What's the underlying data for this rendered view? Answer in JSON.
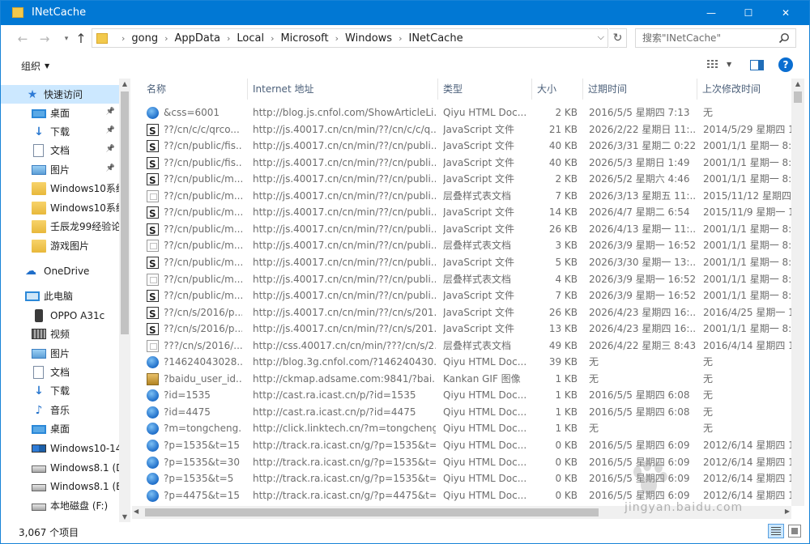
{
  "window": {
    "title": "INetCache",
    "controls": {
      "minimize": "—",
      "maximize": "☐",
      "close": "✕"
    }
  },
  "address": {
    "breadcrumbs": [
      "gong",
      "AppData",
      "Local",
      "Microsoft",
      "Windows",
      "INetCache"
    ],
    "search_placeholder": "搜索\"INetCache\""
  },
  "toolbar": {
    "organize_label": "组织"
  },
  "nav": {
    "items": [
      {
        "label": "快速访问",
        "icon": "star-icon",
        "pinned": false,
        "selected": true
      },
      {
        "label": "桌面",
        "icon": "desktop-icon",
        "pinned": true
      },
      {
        "label": "下载",
        "icon": "download-icon",
        "pinned": true
      },
      {
        "label": "文档",
        "icon": "document-icon",
        "pinned": true
      },
      {
        "label": "图片",
        "icon": "pictures-icon",
        "pinned": true
      },
      {
        "label": "Windows10系统",
        "icon": "folder-icon",
        "pinned": false
      },
      {
        "label": "Windows10系统",
        "icon": "folder-icon",
        "pinned": false
      },
      {
        "label": "壬辰龙99经验论",
        "icon": "folder-icon",
        "pinned": false
      },
      {
        "label": "游戏图片",
        "icon": "folder-icon",
        "pinned": false
      },
      {
        "label": "OneDrive",
        "icon": "onedrive-icon",
        "pinned": false
      },
      {
        "label": "此电脑",
        "icon": "this-pc-icon",
        "pinned": false
      },
      {
        "label": "OPPO A31c",
        "icon": "phone-icon",
        "pinned": false
      },
      {
        "label": "视频",
        "icon": "video-icon",
        "pinned": false
      },
      {
        "label": "图片",
        "icon": "pictures-icon",
        "pinned": false
      },
      {
        "label": "文档",
        "icon": "document-icon",
        "pinned": false
      },
      {
        "label": "下载",
        "icon": "download-icon",
        "pinned": false
      },
      {
        "label": "音乐",
        "icon": "music-icon",
        "pinned": false
      },
      {
        "label": "桌面",
        "icon": "desktop-icon",
        "pinned": false
      },
      {
        "label": "Windows10-14",
        "icon": "windows-drive-icon",
        "pinned": false
      },
      {
        "label": "Windows8.1 (D",
        "icon": "drive-icon",
        "pinned": false
      },
      {
        "label": "Windows8.1 (E",
        "icon": "drive-icon",
        "pinned": false
      },
      {
        "label": "本地磁盘 (F:)",
        "icon": "drive-icon",
        "pinned": false
      }
    ]
  },
  "columns": [
    "名称",
    "Internet 地址",
    "类型",
    "大小",
    "过期时间",
    "上次修改时间"
  ],
  "files": [
    {
      "name": "&css=6001",
      "url": "http://blog.js.cnfol.com/ShowArticleLi...",
      "type": "Qiyu HTML Doc...",
      "size": "2 KB",
      "expires": "2016/5/5 星期四 7:13",
      "modified": "无",
      "kind": "html"
    },
    {
      "name": "??/cn/c/c/qrco...",
      "url": "http://js.40017.cn/cn/min/??/cn/c/c/q...",
      "type": "JavaScript 文件",
      "size": "21 KB",
      "expires": "2026/2/22 星期日 11:...",
      "modified": "2014/5/29 星期四 1",
      "kind": "js"
    },
    {
      "name": "??/cn/public/fis...",
      "url": "http://js.40017.cn/cn/min/??/cn/publi...",
      "type": "JavaScript 文件",
      "size": "40 KB",
      "expires": "2026/3/31 星期二 0:22",
      "modified": "2001/1/1 星期一 8:0",
      "kind": "js"
    },
    {
      "name": "??/cn/public/fis...",
      "url": "http://js.40017.cn/cn/min/??/cn/publi...",
      "type": "JavaScript 文件",
      "size": "40 KB",
      "expires": "2026/5/3 星期日 1:49",
      "modified": "2001/1/1 星期一 8:0",
      "kind": "js"
    },
    {
      "name": "??/cn/public/m...",
      "url": "http://js.40017.cn/cn/min/??/cn/publi...",
      "type": "JavaScript 文件",
      "size": "2 KB",
      "expires": "2026/5/2 星期六 4:46",
      "modified": "2001/1/1 星期一 8:0",
      "kind": "js"
    },
    {
      "name": "??/cn/public/m...",
      "url": "http://js.40017.cn/cn/min/??/cn/publi...",
      "type": "层叠样式表文档",
      "size": "7 KB",
      "expires": "2026/3/13 星期五 11:...",
      "modified": "2015/11/12 星期四",
      "kind": "css"
    },
    {
      "name": "??/cn/public/m...",
      "url": "http://js.40017.cn/cn/min/??/cn/publi...",
      "type": "JavaScript 文件",
      "size": "14 KB",
      "expires": "2026/4/7 星期二 6:54",
      "modified": "2015/11/9 星期一 1",
      "kind": "js"
    },
    {
      "name": "??/cn/public/m...",
      "url": "http://js.40017.cn/cn/min/??/cn/publi...",
      "type": "JavaScript 文件",
      "size": "26 KB",
      "expires": "2026/4/13 星期一 11:...",
      "modified": "2001/1/1 星期一 8:0",
      "kind": "js"
    },
    {
      "name": "??/cn/public/m...",
      "url": "http://js.40017.cn/cn/min/??/cn/publi...",
      "type": "层叠样式表文档",
      "size": "3 KB",
      "expires": "2026/3/9 星期一 16:52",
      "modified": "2001/1/1 星期一 8:0",
      "kind": "css"
    },
    {
      "name": "??/cn/public/m...",
      "url": "http://js.40017.cn/cn/min/??/cn/publi...",
      "type": "JavaScript 文件",
      "size": "5 KB",
      "expires": "2026/3/30 星期一 13:...",
      "modified": "2001/1/1 星期一 8:0",
      "kind": "js"
    },
    {
      "name": "??/cn/public/m...",
      "url": "http://js.40017.cn/cn/min/??/cn/publi...",
      "type": "层叠样式表文档",
      "size": "4 KB",
      "expires": "2026/3/9 星期一 16:52",
      "modified": "2001/1/1 星期一 8:0",
      "kind": "css"
    },
    {
      "name": "??/cn/public/m...",
      "url": "http://js.40017.cn/cn/min/??/cn/publi...",
      "type": "JavaScript 文件",
      "size": "7 KB",
      "expires": "2026/3/9 星期一 16:52",
      "modified": "2001/1/1 星期一 8:0",
      "kind": "js"
    },
    {
      "name": "??/cn/s/2016/p...",
      "url": "http://js.40017.cn/cn/min/??/cn/s/201...",
      "type": "JavaScript 文件",
      "size": "26 KB",
      "expires": "2026/4/23 星期四 16:...",
      "modified": "2016/4/25 星期一 1",
      "kind": "js"
    },
    {
      "name": "??/cn/s/2016/p...",
      "url": "http://js.40017.cn/cn/min/??/cn/s/201...",
      "type": "JavaScript 文件",
      "size": "13 KB",
      "expires": "2026/4/23 星期四 16:...",
      "modified": "2001/1/1 星期一 8:0",
      "kind": "js"
    },
    {
      "name": "???/cn/s/2016/...",
      "url": "http://css.40017.cn/cn/min/???/cn/s/2...",
      "type": "层叠样式表文档",
      "size": "49 KB",
      "expires": "2026/4/22 星期三 8:43",
      "modified": "2016/4/14 星期四 1",
      "kind": "css"
    },
    {
      "name": "?14624043028...",
      "url": "http://blog.3g.cnfol.com/?146240430...",
      "type": "Qiyu HTML Doc...",
      "size": "39 KB",
      "expires": "无",
      "modified": "无",
      "kind": "html"
    },
    {
      "name": "?baidu_user_id...",
      "url": "http://ckmap.adsame.com:9841/?bai...",
      "type": "Kankan GIF 图像",
      "size": "1 KB",
      "expires": "无",
      "modified": "无",
      "kind": "gif"
    },
    {
      "name": "?id=1535",
      "url": "http://cast.ra.icast.cn/p/?id=1535",
      "type": "Qiyu HTML Doc...",
      "size": "1 KB",
      "expires": "2016/5/5 星期四 6:08",
      "modified": "无",
      "kind": "html"
    },
    {
      "name": "?id=4475",
      "url": "http://cast.ra.icast.cn/p/?id=4475",
      "type": "Qiyu HTML Doc...",
      "size": "1 KB",
      "expires": "2016/5/5 星期四 6:08",
      "modified": "无",
      "kind": "html"
    },
    {
      "name": "?m=tongcheng...",
      "url": "http://click.linktech.cn/?m=tongcheng...",
      "type": "Qiyu HTML Doc...",
      "size": "1 KB",
      "expires": "无",
      "modified": "无",
      "kind": "html"
    },
    {
      "name": "?p=1535&t=15",
      "url": "http://track.ra.icast.cn/g/?p=1535&t=...",
      "type": "Qiyu HTML Doc...",
      "size": "0 KB",
      "expires": "2016/5/5 星期四 6:09",
      "modified": "2012/6/14 星期四 1",
      "kind": "html"
    },
    {
      "name": "?p=1535&t=30",
      "url": "http://track.ra.icast.cn/g/?p=1535&t=...",
      "type": "Qiyu HTML Doc...",
      "size": "0 KB",
      "expires": "2016/5/5 星期四 6:09",
      "modified": "2012/6/14 星期四 1",
      "kind": "html"
    },
    {
      "name": "?p=1535&t=5",
      "url": "http://track.ra.icast.cn/g/?p=1535&t=5",
      "type": "Qiyu HTML Doc...",
      "size": "0 KB",
      "expires": "2016/5/5 星期四 6:09",
      "modified": "2012/6/14 星期四 1",
      "kind": "html"
    },
    {
      "name": "?p=4475&t=15",
      "url": "http://track.ra.icast.cn/g/?p=4475&t=...",
      "type": "Qiyu HTML Doc...",
      "size": "0 KB",
      "expires": "2016/5/5 星期四 6:09",
      "modified": "2012/6/14 星期四 1",
      "kind": "html"
    }
  ],
  "status": {
    "item_count": "3,067 个项目"
  },
  "watermark": {
    "text": "jingyan.baidu.com"
  },
  "colors": {
    "titlebar": "#0178d4",
    "selection": "#cce8ff",
    "header_text": "#4c607a"
  }
}
